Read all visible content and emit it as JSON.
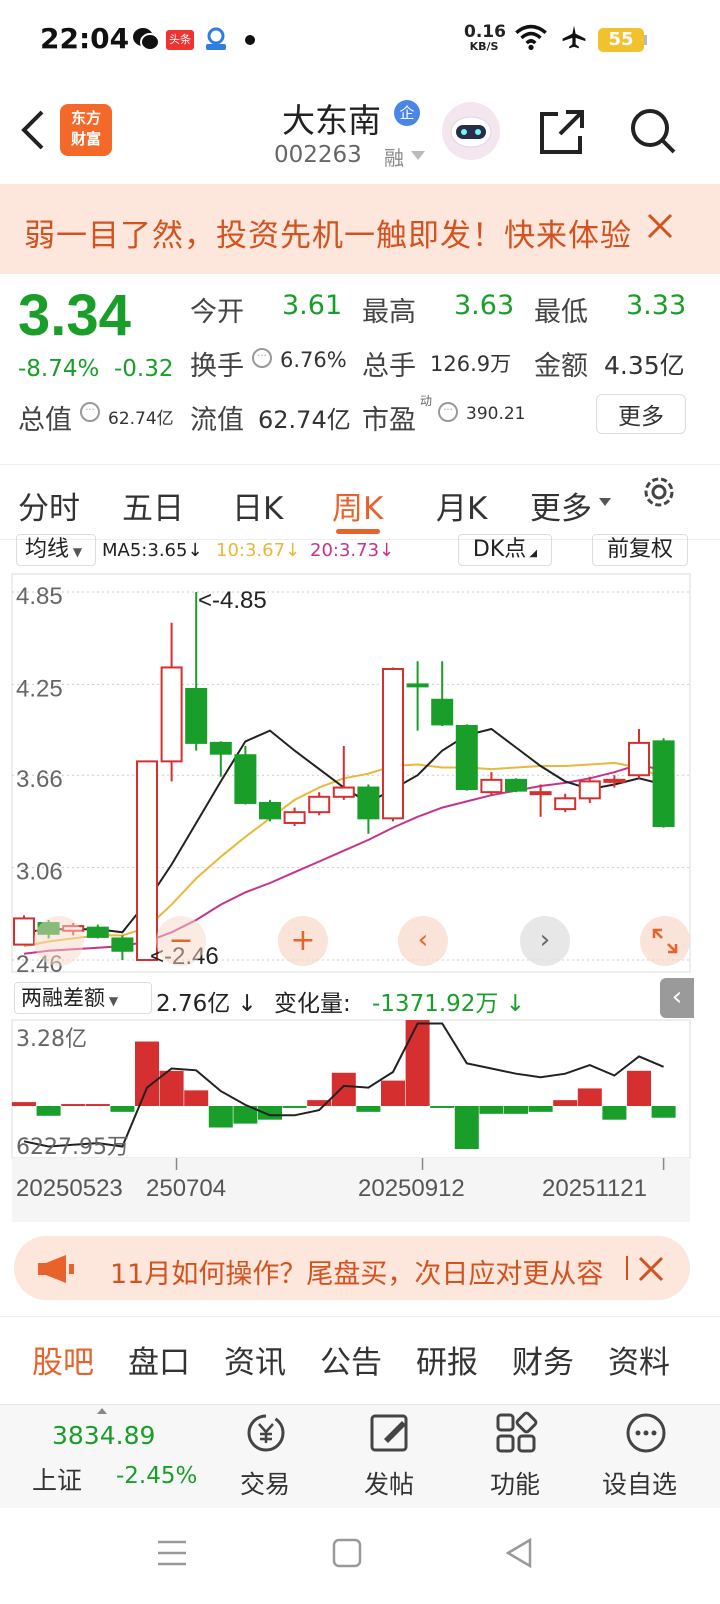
{
  "status_bar": {
    "time": "22:04",
    "net_speed": "0.16",
    "net_unit": "KB/S",
    "battery": "55",
    "toutiao_badge": "头条"
  },
  "header": {
    "title": "大东南",
    "code": "002263",
    "tag": "企",
    "margin_tag": "融",
    "logo_line1": "东方",
    "logo_line2": "财富"
  },
  "banner": {
    "text": "弱一目了然，投资先机一触即发！快来体验"
  },
  "quote": {
    "price": "3.34",
    "change_pct": "-8.74%",
    "change": "-0.32",
    "open_label": "今开",
    "open": "3.61",
    "high_label": "最高",
    "high": "3.63",
    "low_label": "最低",
    "low": "3.33",
    "turnover_label": "换手",
    "turnover": "6.76%",
    "volume_label": "总手",
    "volume": "126.9万",
    "amount_label": "金额",
    "amount": "4.35亿",
    "mcap_label": "总值",
    "mcap": "62.74亿",
    "float_label": "流值",
    "float_cap": "62.74亿",
    "pe_label": "市盈",
    "pe_sup": "动",
    "pe": "390.21",
    "more": "更多"
  },
  "tabs": [
    "分时",
    "五日",
    "日K",
    "周K",
    "月K",
    "更多"
  ],
  "active_tab": "周K",
  "indicator_bar": {
    "selector": "均线",
    "ma5": "MA5:3.65",
    "ma10": "10:3.67",
    "ma20": "20:3.73",
    "dk": "DK点",
    "fq": "前复权"
  },
  "colors": {
    "up": "#d62f2f",
    "down": "#1a9e2a",
    "ma5": "#222222",
    "ma10": "#e8b83a",
    "ma20": "#c8338a",
    "accent": "#e8622b"
  },
  "chart_data": [
    {
      "type": "candlestick",
      "y_axis_labels": [
        "4.85",
        "4.25",
        "3.66",
        "3.06",
        "2.46"
      ],
      "annotations": [
        "<-4.85",
        "<-2.46"
      ],
      "ylim": [
        2.46,
        4.85
      ],
      "candles": [
        {
          "o": 2.56,
          "c": 2.73,
          "h": 2.75,
          "l": 2.56
        },
        {
          "o": 2.7,
          "c": 2.63,
          "h": 2.72,
          "l": 2.6
        },
        {
          "o": 2.65,
          "c": 2.68,
          "h": 2.7,
          "l": 2.62
        },
        {
          "o": 2.67,
          "c": 2.61,
          "h": 2.69,
          "l": 2.6
        },
        {
          "o": 2.6,
          "c": 2.52,
          "h": 2.62,
          "l": 2.46
        },
        {
          "o": 2.46,
          "c": 3.75,
          "h": 3.75,
          "l": 2.46
        },
        {
          "o": 3.75,
          "c": 4.36,
          "h": 4.65,
          "l": 3.62
        },
        {
          "o": 4.22,
          "c": 3.87,
          "h": 4.85,
          "l": 3.82
        },
        {
          "o": 3.87,
          "c": 3.8,
          "h": 3.88,
          "l": 3.65
        },
        {
          "o": 3.79,
          "c": 3.48,
          "h": 3.85,
          "l": 3.47
        },
        {
          "o": 3.48,
          "c": 3.38,
          "h": 3.5,
          "l": 3.36
        },
        {
          "o": 3.35,
          "c": 3.42,
          "h": 3.45,
          "l": 3.33
        },
        {
          "o": 3.42,
          "c": 3.52,
          "h": 3.55,
          "l": 3.4
        },
        {
          "o": 3.52,
          "c": 3.58,
          "h": 3.85,
          "l": 3.5
        },
        {
          "o": 3.58,
          "c": 3.38,
          "h": 3.6,
          "l": 3.28
        },
        {
          "o": 3.38,
          "c": 4.35,
          "h": 4.36,
          "l": 3.36
        },
        {
          "o": 4.25,
          "c": 4.24,
          "h": 4.4,
          "l": 3.95
        },
        {
          "o": 4.15,
          "c": 3.99,
          "h": 4.4,
          "l": 3.98
        },
        {
          "o": 3.98,
          "c": 3.57,
          "h": 3.99,
          "l": 3.56
        },
        {
          "o": 3.55,
          "c": 3.63,
          "h": 3.68,
          "l": 3.53
        },
        {
          "o": 3.63,
          "c": 3.56,
          "h": 3.64,
          "l": 3.55
        },
        {
          "o": 3.55,
          "c": 3.55,
          "h": 3.6,
          "l": 3.39
        },
        {
          "o": 3.44,
          "c": 3.51,
          "h": 3.54,
          "l": 3.42
        },
        {
          "o": 3.51,
          "c": 3.62,
          "h": 3.65,
          "l": 3.48
        },
        {
          "o": 3.62,
          "c": 3.63,
          "h": 3.66,
          "l": 3.58
        },
        {
          "o": 3.66,
          "c": 3.87,
          "h": 3.96,
          "l": 3.64
        },
        {
          "o": 3.88,
          "c": 3.33,
          "h": 3.9,
          "l": 3.32
        }
      ],
      "ma5": [
        2.64,
        2.66,
        2.66,
        2.66,
        2.64,
        2.84,
        3.08,
        3.35,
        3.62,
        3.88,
        3.95,
        3.82,
        3.7,
        3.58,
        3.48,
        3.57,
        3.66,
        3.82,
        3.92,
        3.96,
        3.84,
        3.72,
        3.62,
        3.57,
        3.6,
        3.64,
        3.6
      ],
      "ma10": [
        2.55,
        2.58,
        2.6,
        2.62,
        2.62,
        2.67,
        2.82,
        2.99,
        3.13,
        3.26,
        3.38,
        3.5,
        3.58,
        3.64,
        3.67,
        3.72,
        3.73,
        3.71,
        3.71,
        3.7,
        3.71,
        3.72,
        3.72,
        3.73,
        3.74,
        3.71,
        3.64
      ],
      "ma20": [
        2.5,
        2.52,
        2.53,
        2.54,
        2.55,
        2.58,
        2.64,
        2.72,
        2.82,
        2.9,
        2.96,
        3.03,
        3.1,
        3.17,
        3.24,
        3.32,
        3.39,
        3.45,
        3.49,
        3.53,
        3.56,
        3.59,
        3.61,
        3.64,
        3.68,
        3.73,
        3.69
      ]
    },
    {
      "type": "bar",
      "title": "两融差额",
      "value": "2.76亿",
      "change_label": "变化量:",
      "change": "-1371.92万",
      "y_axis_labels": [
        "3.28亿",
        "6227.95万"
      ],
      "x_tick_labels": [
        "20250523",
        "250704",
        "20250912",
        "20251121"
      ],
      "values": [
        0.02,
        -0.05,
        0.01,
        0.01,
        -0.03,
        0.33,
        0.18,
        0.08,
        -0.11,
        -0.09,
        -0.07,
        -0.01,
        0.03,
        0.17,
        -0.03,
        0.13,
        0.44,
        -0.01,
        -0.22,
        -0.04,
        -0.04,
        -0.03,
        0.03,
        0.09,
        -0.07,
        0.18,
        -0.06
      ],
      "line": [
        2.35,
        2.32,
        2.33,
        2.34,
        2.32,
        2.66,
        2.77,
        2.76,
        2.64,
        2.56,
        2.5,
        2.5,
        2.53,
        2.67,
        2.66,
        2.75,
        3.03,
        3.03,
        2.8,
        2.77,
        2.74,
        2.72,
        2.74,
        2.79,
        2.73,
        2.84,
        2.78
      ]
    }
  ],
  "notice": {
    "text": "11月如何操作？尾盘买，次日应对更从容"
  },
  "sub_tabs": [
    "股吧",
    "盘口",
    "资讯",
    "公告",
    "研报",
    "财务",
    "资料"
  ],
  "bottom_bar": {
    "index_value": "3834.89",
    "index_name": "上证",
    "index_change": "-2.45%",
    "items": [
      "交易",
      "发帖",
      "功能",
      "设自选"
    ]
  }
}
